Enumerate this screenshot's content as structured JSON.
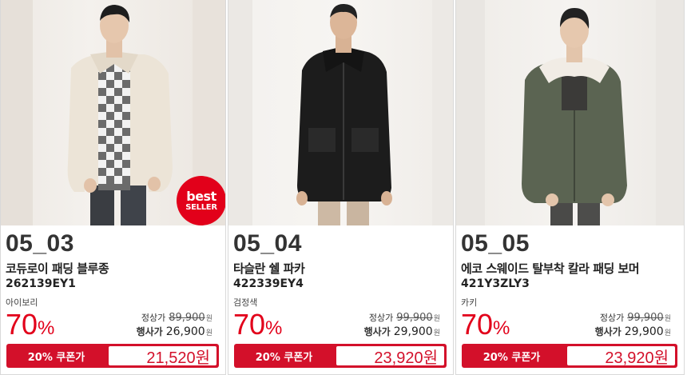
{
  "products": [
    {
      "code": "05_03",
      "name": "코듀로이 패딩 블루종",
      "sku": "262139EY1",
      "color": "아이보리",
      "discount": "70",
      "discount_unit": "%",
      "regular_label": "정상가",
      "regular_price": "89,900",
      "sale_label": "행사가",
      "sale_price": "26,900",
      "won": "원",
      "coupon_label": "20% 쿠폰가",
      "coupon_price": "21,520원",
      "badge_line1": "best",
      "badge_line2": "SELLER"
    },
    {
      "code": "05_04",
      "name": "타슬란 쉘 파카",
      "sku": "422339EY4",
      "color": "검정색",
      "discount": "70",
      "discount_unit": "%",
      "regular_label": "정상가",
      "regular_price": "99,900",
      "sale_label": "행사가",
      "sale_price": "29,900",
      "won": "원",
      "coupon_label": "20% 쿠폰가",
      "coupon_price": "23,920원"
    },
    {
      "code": "05_05",
      "name": "에코 스웨이드 탈부착 칼라 패딩 보머",
      "sku": "421Y3ZLY3",
      "color": "카키",
      "discount": "70",
      "discount_unit": "%",
      "regular_label": "정상가",
      "regular_price": "99,900",
      "sale_label": "행사가",
      "sale_price": "29,900",
      "won": "원",
      "coupon_label": "20% 쿠폰가",
      "coupon_price": "23,920원"
    }
  ],
  "colors": {
    "accent_red": "#e2001a",
    "coupon_red": "#d3102a"
  }
}
